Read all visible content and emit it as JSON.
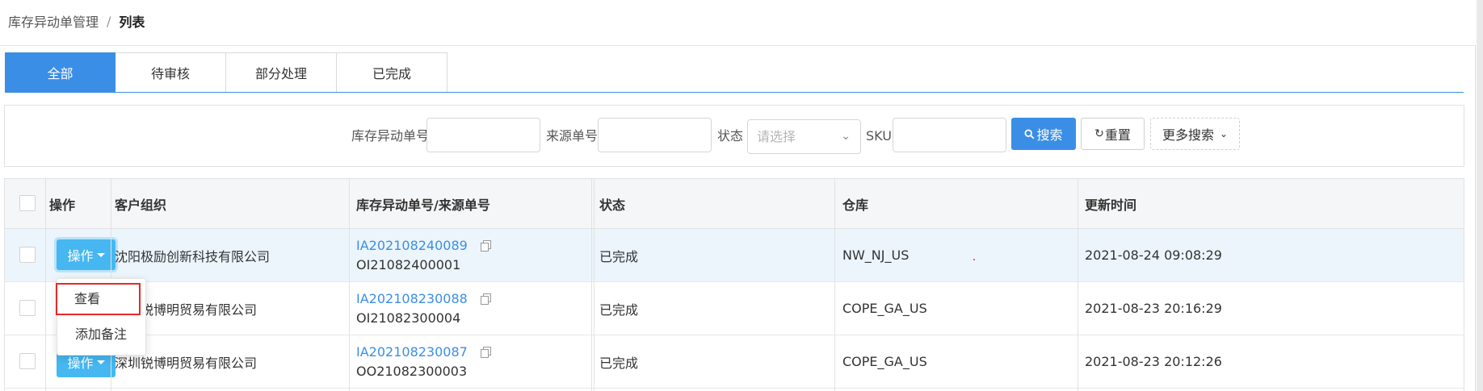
{
  "breadcrumb": {
    "parent": "库存异动单管理",
    "separator": "/",
    "current": "列表"
  },
  "tabs": [
    {
      "label": "全部",
      "active": true
    },
    {
      "label": "待审核",
      "active": false
    },
    {
      "label": "部分处理",
      "active": false
    },
    {
      "label": "已完成",
      "active": false
    }
  ],
  "filters": {
    "movement_no_label": "库存异动单号",
    "movement_no_value": "",
    "source_no_label": "来源单号",
    "source_no_value": "",
    "status_label": "状态",
    "status_placeholder": "请选择",
    "sku_label": "SKU",
    "sku_value": "",
    "search_label": "搜索",
    "reset_label": "重置",
    "more_label": "更多搜索"
  },
  "table": {
    "headers": {
      "operation": "操作",
      "customer": "客户组织",
      "order_no": "库存异动单号/来源单号",
      "status": "状态",
      "warehouse": "仓库",
      "updated": "更新时间"
    },
    "operation_button_label": "操作",
    "rows": [
      {
        "customer": "沈阳极励创新科技有限公司",
        "movement_no": "IA202108240089",
        "source_no": "OI21082400001",
        "status": "已完成",
        "warehouse": "NW_NJ_US",
        "updated": "2021-08-24 09:08:29"
      },
      {
        "customer": "深圳锐博明贸易有限公司",
        "movement_no": "IA202108230088",
        "source_no": "OI21082300004",
        "status": "已完成",
        "warehouse": "COPE_GA_US",
        "updated": "2021-08-23 20:16:29"
      },
      {
        "customer": "深圳锐博明贸易有限公司",
        "movement_no": "IA202108230087",
        "source_no": "OO21082300003",
        "status": "已完成",
        "warehouse": "COPE_GA_US",
        "updated": "2021-08-23 20:12:26"
      }
    ]
  },
  "dropdown_menu": {
    "items": [
      "查看",
      "添加备注"
    ]
  },
  "colors": {
    "primary": "#3a8ee6",
    "operation_button": "#46b7f0",
    "highlight_row": "#ecf5fb",
    "focus_box": "#e32a2a"
  },
  "icons": {
    "search": "search-icon",
    "reset": "refresh-icon",
    "more": "chevron-down-icon",
    "copy": "copy-icon"
  }
}
